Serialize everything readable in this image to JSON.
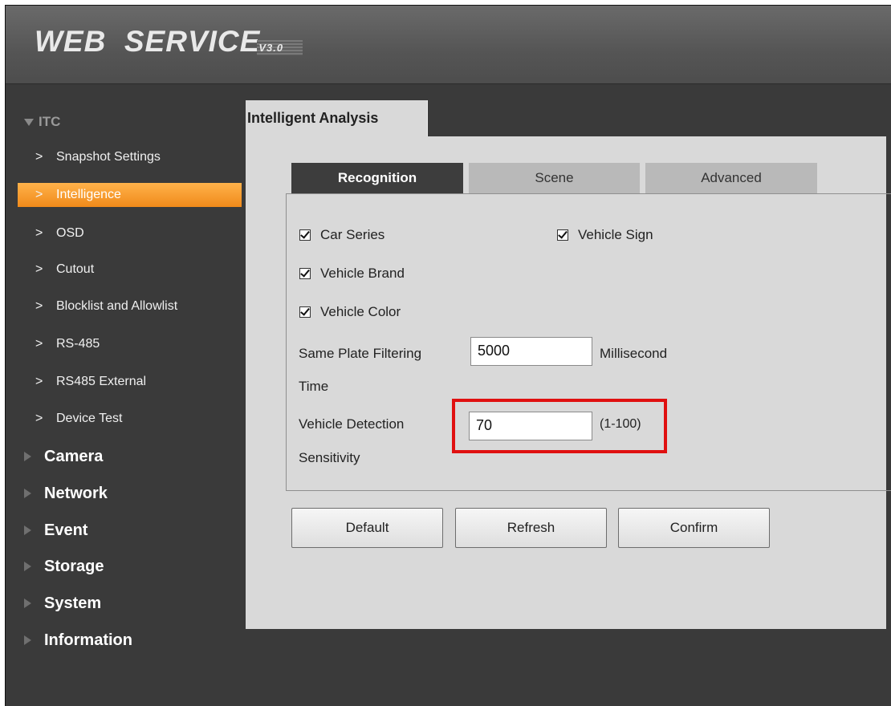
{
  "header": {
    "logo_main": "WEB  SERVICE",
    "logo_version": "V3.0"
  },
  "sidebar": {
    "root": "ITC",
    "items": [
      {
        "label": "Snapshot Settings",
        "active": false
      },
      {
        "label": "Intelligence",
        "active": true
      },
      {
        "label": "OSD",
        "active": false
      },
      {
        "label": "Cutout",
        "active": false
      },
      {
        "label": "Blocklist and Allowlist",
        "active": false
      },
      {
        "label": "RS-485",
        "active": false
      },
      {
        "label": "RS485 External",
        "active": false
      },
      {
        "label": "Device Test",
        "active": false
      }
    ],
    "sections": [
      "Camera",
      "Network",
      "Event",
      "Storage",
      "System",
      "Information"
    ],
    "chevron_glyph": ">"
  },
  "page": {
    "title": "Intelligent Analysis"
  },
  "tabs": [
    {
      "label": "Recognition",
      "active": true
    },
    {
      "label": "Scene",
      "active": false
    },
    {
      "label": "Advanced",
      "active": false
    }
  ],
  "recognition": {
    "car_series": {
      "label": "Car Series",
      "checked": true
    },
    "vehicle_sign": {
      "label": "Vehicle Sign",
      "checked": true
    },
    "vehicle_brand": {
      "label": "Vehicle Brand",
      "checked": true
    },
    "vehicle_color": {
      "label": "Vehicle Color",
      "checked": true
    },
    "filter_time": {
      "label_line1": "Same Plate Filtering",
      "label_line2": "Time",
      "value": "5000",
      "unit": "Millisecond"
    },
    "sensitivity": {
      "label_line1": "Vehicle Detection",
      "label_line2": "Sensitivity",
      "value": "70",
      "range": "(1-100)"
    }
  },
  "buttons": {
    "default": "Default",
    "refresh": "Refresh",
    "confirm": "Confirm"
  },
  "colors": {
    "active_menu": "#f39a2a",
    "highlight_box": "#e01010",
    "active_tab": "#3d3d3d"
  }
}
